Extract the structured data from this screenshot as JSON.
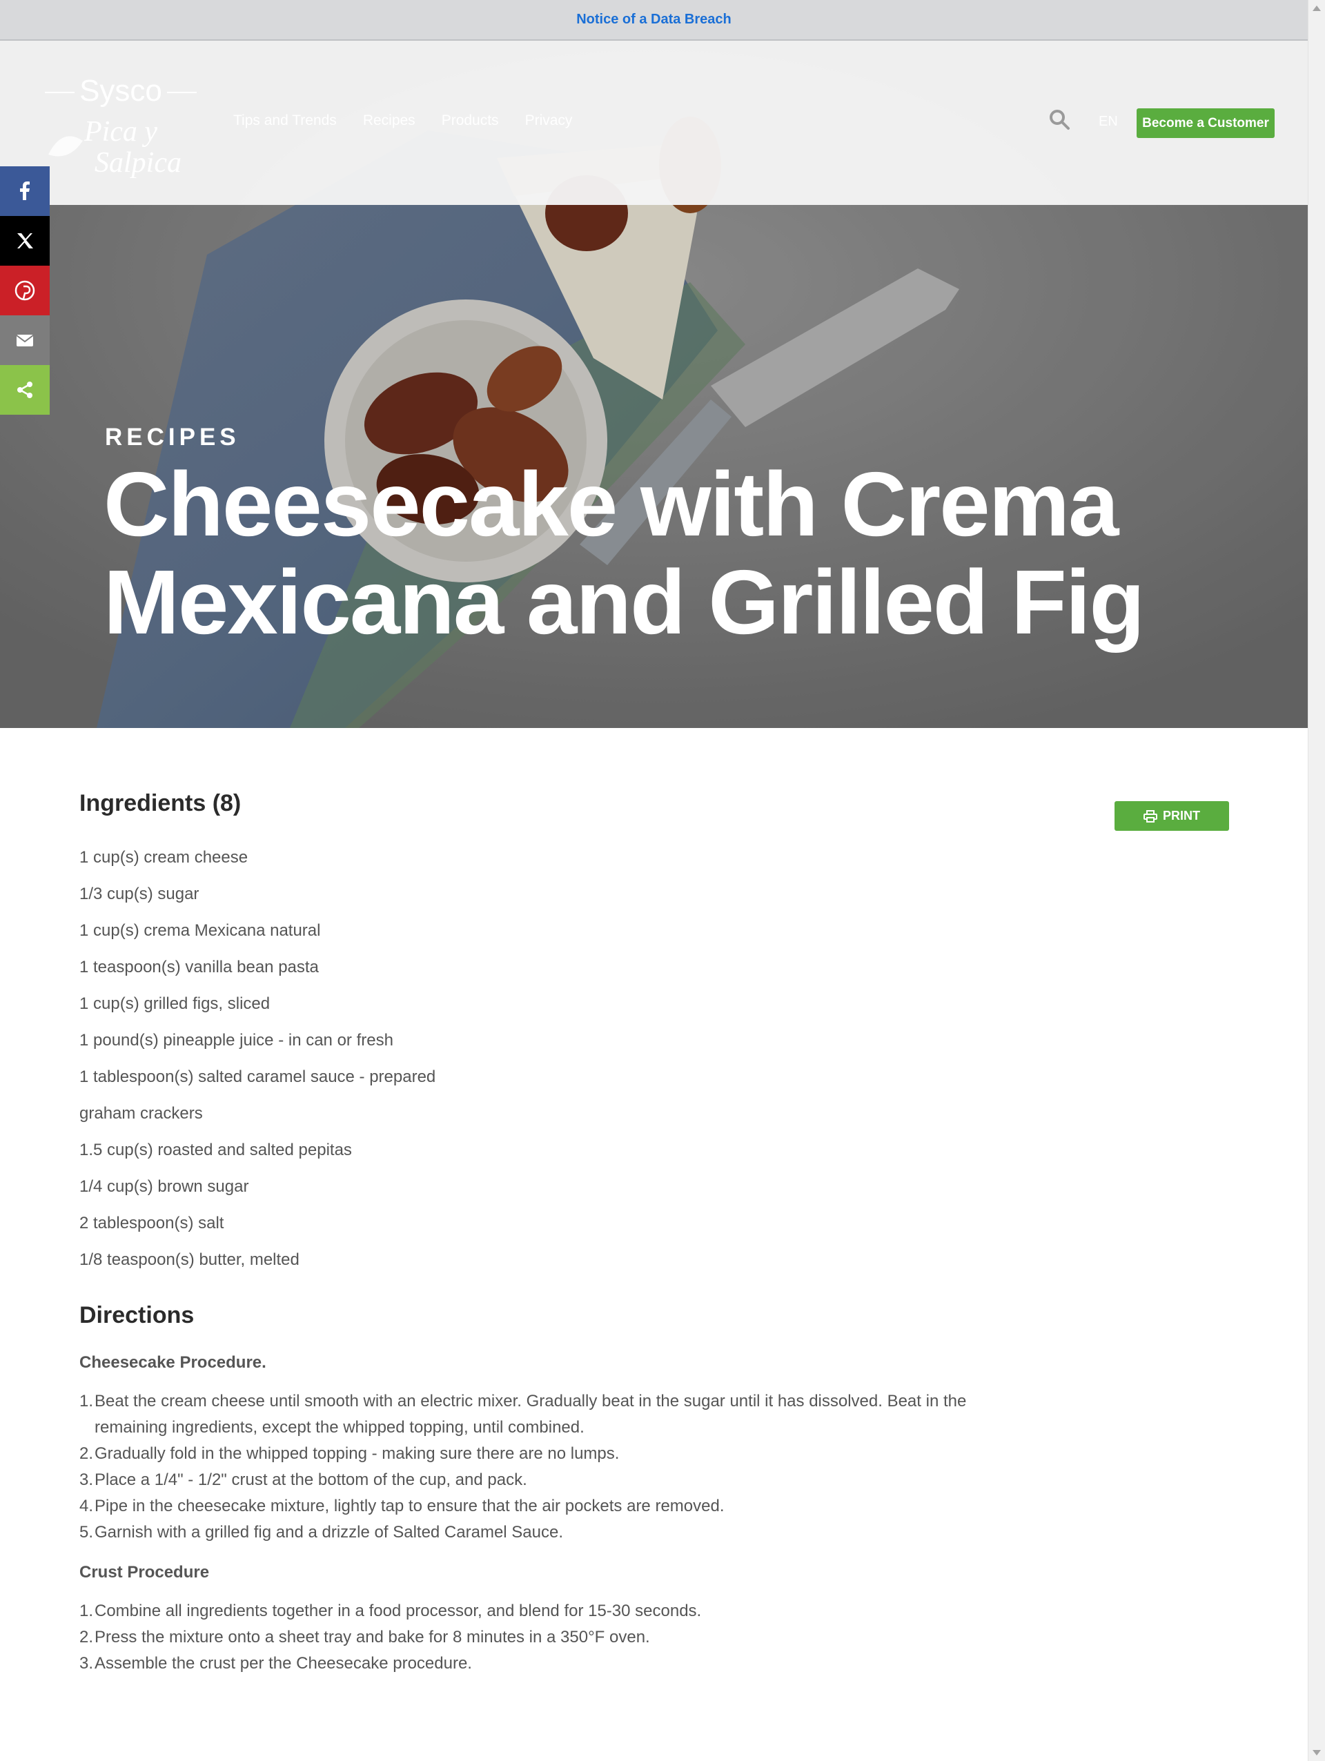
{
  "notice": {
    "link_text": "Notice of a Data Breach"
  },
  "header": {
    "logo": {
      "brand": "Sysco",
      "sub1": "Pica y",
      "sub2": "Salpica"
    },
    "nav": [
      "Tips and Trends",
      "Recipes",
      "Products",
      "Privacy"
    ],
    "lang": "EN",
    "cta": "Become a Customer"
  },
  "hero": {
    "eyebrow": "RECIPES",
    "title": "Cheesecake with Crema Mexicana and Grilled Fig"
  },
  "share": [
    "facebook-icon",
    "x-icon",
    "pinterest-icon",
    "email-icon",
    "share-icon"
  ],
  "print_label": "PRINT",
  "ingredients": {
    "heading": "Ingredients (8)",
    "items": [
      "1 cup(s) cream cheese",
      "1/3 cup(s) sugar",
      "1 cup(s) crema Mexicana natural",
      "1 teaspoon(s) vanilla bean pasta",
      "1 cup(s) grilled figs, sliced",
      "1 pound(s) pineapple juice - in can or fresh",
      "1 tablespoon(s) salted caramel sauce - prepared",
      "graham crackers",
      "1.5 cup(s) roasted and salted pepitas",
      "1/4 cup(s) brown sugar",
      "2 tablespoon(s) salt",
      "1/8 teaspoon(s) butter, melted"
    ]
  },
  "directions": {
    "heading": "Directions",
    "sections": [
      {
        "title": "Cheesecake Procedure.",
        "steps": [
          "Beat the cream cheese until smooth with an electric mixer. Gradually beat in the sugar until it has dissolved. Beat in the remaining ingredients, except the whipped topping, until combined.",
          "Gradually fold in the whipped topping - making sure there are no lumps.",
          "Place a 1/4\" - 1/2\" crust at the bottom of the cup, and pack.",
          "Pipe in the cheesecake mixture, lightly tap to ensure that the air pockets are removed.",
          "Garnish with a grilled fig and a drizzle of Salted Caramel Sauce."
        ]
      },
      {
        "title": "Crust Procedure",
        "steps": [
          "Combine all ingredients together in a food processor, and blend for 15-30 seconds.",
          "Press the mixture onto a sheet tray and bake for 8 minutes in a 350°F oven.",
          "Assemble the crust per the Cheesecake procedure."
        ]
      }
    ]
  },
  "colors": {
    "accent_green": "#5aad3f",
    "link_blue": "#1a6fd6"
  }
}
